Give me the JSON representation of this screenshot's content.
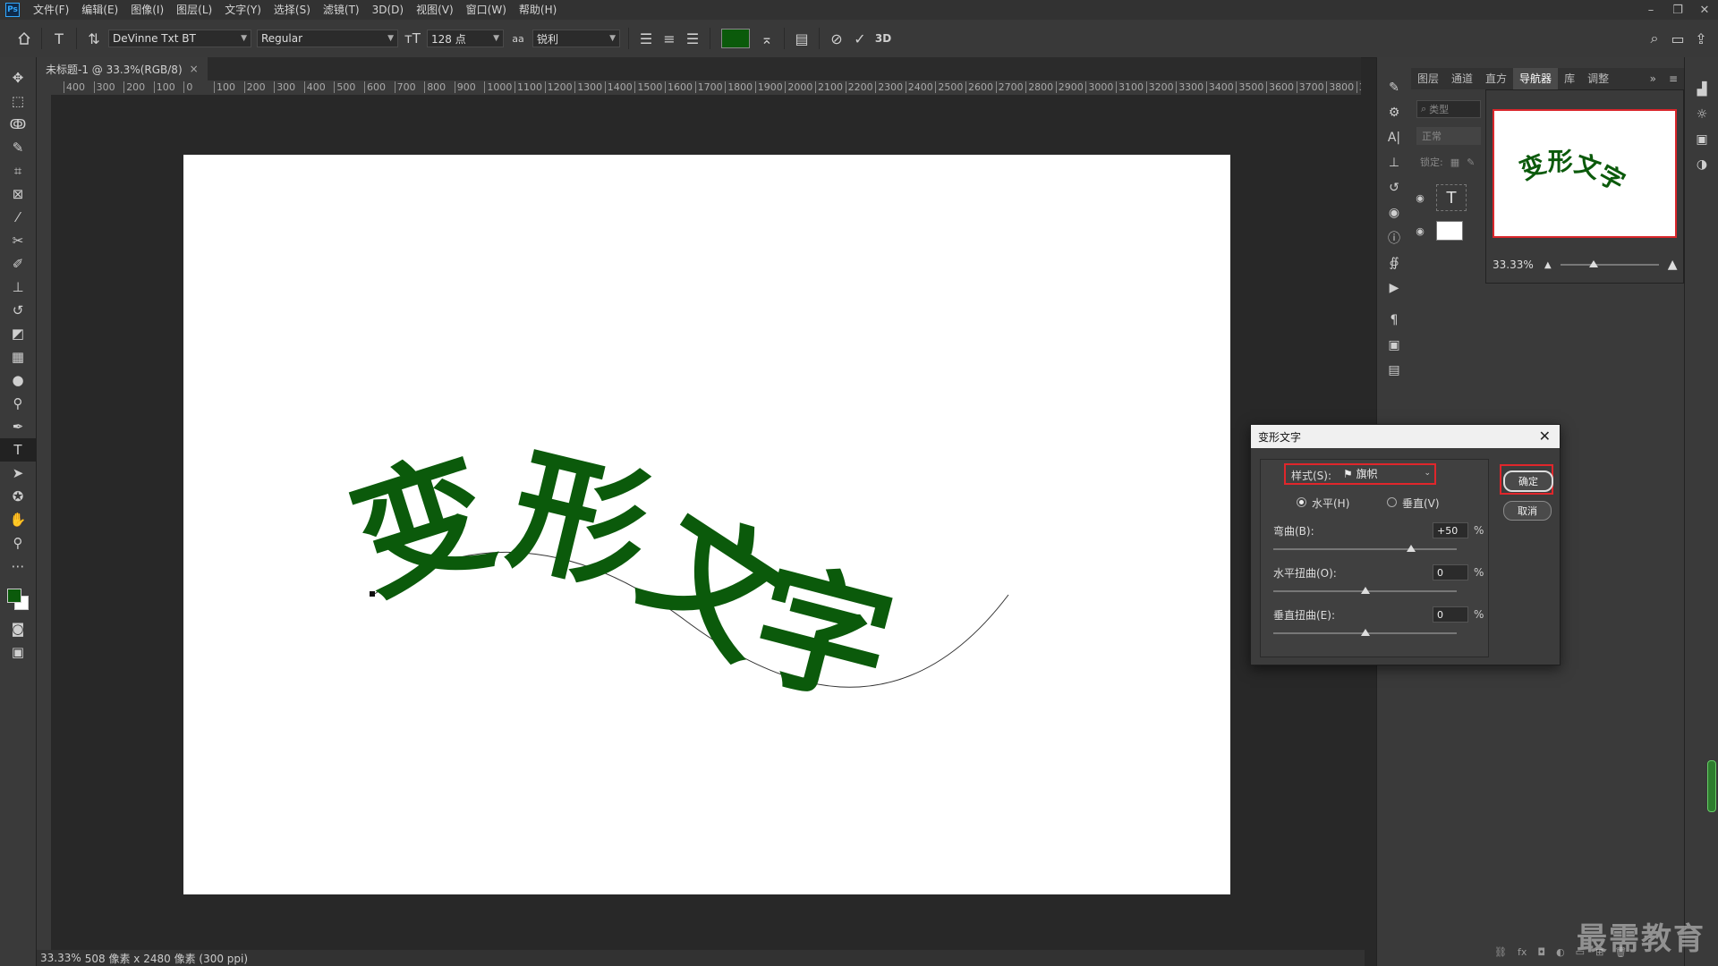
{
  "menubar": {
    "logo": "Ps",
    "items": [
      "文件(F)",
      "编辑(E)",
      "图像(I)",
      "图层(L)",
      "文字(Y)",
      "选择(S)",
      "滤镜(T)",
      "3D(D)",
      "视图(V)",
      "窗口(W)",
      "帮助(H)"
    ]
  },
  "options": {
    "font_family": "DeVinne Txt BT",
    "font_style": "Regular",
    "font_size": "128 点",
    "antialias_icon": "aa",
    "antialias": "锐利",
    "text_color": "#0b5a0b",
    "three_d": "3D"
  },
  "document": {
    "tab_title": "未标题-1 @ 33.3%(RGB/8)",
    "close_glyph": "×",
    "warped_text": "变形文字",
    "text_color": "#0b5a0b"
  },
  "ruler": {
    "top_labels": [
      "400",
      "300",
      "200",
      "100",
      "0",
      "100",
      "200",
      "300",
      "400",
      "500",
      "600",
      "700",
      "800",
      "900",
      "1000",
      "1100",
      "1200",
      "1300",
      "1400",
      "1500",
      "1600",
      "1700",
      "1800",
      "1900",
      "2000",
      "2100",
      "2200",
      "2300",
      "2400",
      "2500",
      "2600",
      "2700",
      "2800",
      "2900",
      "3000",
      "3100",
      "3200",
      "3300",
      "3400",
      "3500",
      "3600",
      "3700",
      "3800",
      "39"
    ]
  },
  "status": {
    "zoom": "33.33%",
    "size": "508 像素 x 2480 像素 (300 ppi)"
  },
  "layers_panel": {
    "tabs": [
      "图层",
      "通道",
      "直方",
      "导航器",
      "库",
      "调整"
    ],
    "active_tab": "导航器",
    "more_glyph": "»",
    "filter_placeholder": "类型",
    "blend_mode": "正常",
    "lock_label": "锁定:",
    "type_layer_glyph": "T"
  },
  "navigator": {
    "preview_text": "变形文字",
    "zoom": "33.33%"
  },
  "warp_dialog": {
    "title": "变形文字",
    "style_label": "样式(S):",
    "style_value": "旗帜",
    "horizontal_label": "水平(H)",
    "vertical_label": "垂直(V)",
    "orientation": "horizontal",
    "bend_label": "弯曲(B):",
    "bend_value": "+50",
    "bend_fraction": 0.75,
    "hdistort_label": "水平扭曲(O):",
    "hdistort_value": "0",
    "hdistort_fraction": 0.5,
    "vdistort_label": "垂直扭曲(E):",
    "vdistort_value": "0",
    "vdistort_fraction": 0.5,
    "percent": "%",
    "ok_label": "确定",
    "cancel_label": "取消"
  },
  "watermark": "最需教育"
}
